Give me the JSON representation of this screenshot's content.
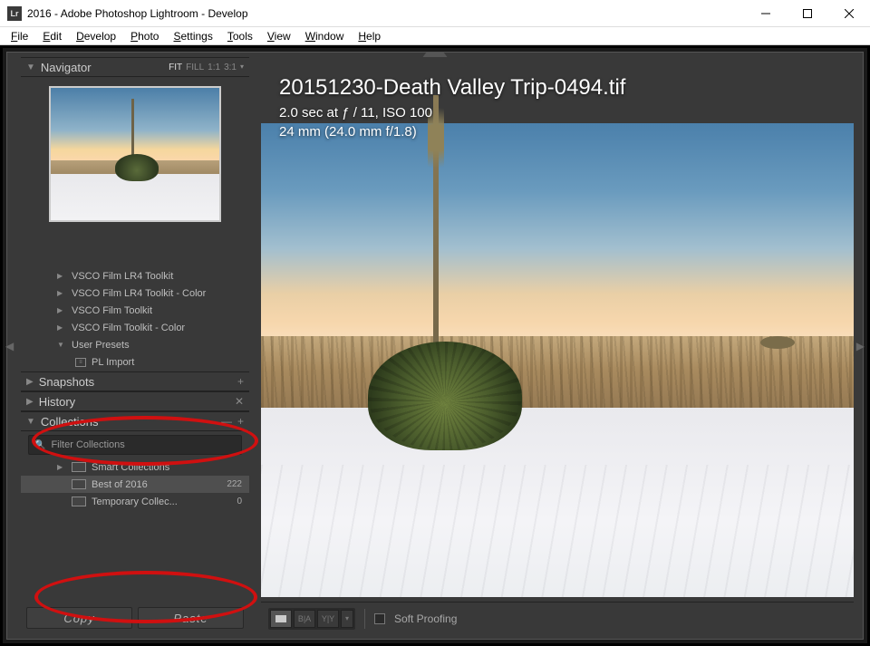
{
  "window": {
    "title": "2016 - Adobe Photoshop Lightroom - Develop",
    "logo_text": "Lr"
  },
  "menu": [
    "File",
    "Edit",
    "Develop",
    "Photo",
    "Settings",
    "Tools",
    "View",
    "Window",
    "Help"
  ],
  "navigator": {
    "title": "Navigator",
    "zoom": [
      "FIT",
      "FILL",
      "1:1",
      "3:1"
    ],
    "zoom_active": "FIT"
  },
  "presets": {
    "items": [
      {
        "label": "VSCO Film LR4 Toolkit",
        "expanded": false
      },
      {
        "label": "VSCO Film LR4 Toolkit - Color",
        "expanded": false
      },
      {
        "label": "VSCO Film Toolkit",
        "expanded": false
      },
      {
        "label": "VSCO Film Toolkit - Color",
        "expanded": false
      },
      {
        "label": "User Presets",
        "expanded": true,
        "children": [
          {
            "label": "PL Import"
          }
        ]
      }
    ]
  },
  "panels": {
    "snapshots": "Snapshots",
    "history": "History",
    "collections": "Collections"
  },
  "collections": {
    "filter_placeholder": "Filter Collections",
    "items": [
      {
        "label": "Smart Collections",
        "count": "",
        "selected": false,
        "expanded": false
      },
      {
        "label": "Best of 2016",
        "count": "222",
        "selected": true,
        "expanded": false
      },
      {
        "label": "Temporary Collec...",
        "count": "0",
        "selected": false,
        "expanded": false
      }
    ]
  },
  "buttons": {
    "copy": "Copy",
    "paste": "Paste"
  },
  "image_info": {
    "filename": "20151230-Death Valley Trip-0494.tif",
    "exposure": "2.0 sec at ƒ / 11, ISO 100",
    "lens": "24 mm (24.0 mm f/1.8)"
  },
  "toolbar": {
    "soft_proofing": "Soft Proofing",
    "view_modes": [
      "single",
      "BA",
      "YY"
    ]
  }
}
